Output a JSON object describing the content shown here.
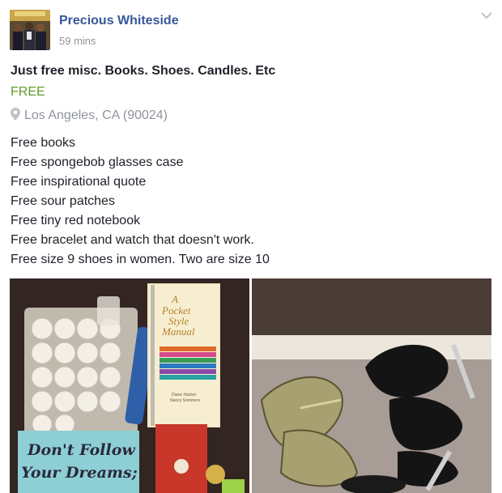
{
  "post": {
    "author": "Precious Whiteside",
    "time": "59 mins"
  },
  "listing": {
    "title": "Just free misc. Books. Shoes. Candles. Etc",
    "price": "FREE",
    "location": "Los Angeles, CA (90024)",
    "description": [
      "Free books",
      "Free spongebob glasses case",
      "Free inspirational quote",
      "Free sour patches",
      "Free tiny red notebook",
      "Free bracelet and watch that doesn't work.",
      "Free size 9 shoes in women. Two are size 10"
    ]
  },
  "photo_items_text": {
    "book_title": "A Pocket Style Manual",
    "book_author": "Diane Hacker Nancy Sommers",
    "sign_line_1": "Don't Follow",
    "sign_line_2": "Your Dreams;"
  },
  "colors": {
    "author_link": "#365899",
    "price_green": "#5f9e28",
    "muted_gray": "#90949c",
    "text": "#1d2129"
  },
  "icons": {
    "location": "map-pin-icon",
    "menu": "chevron-down-icon"
  }
}
